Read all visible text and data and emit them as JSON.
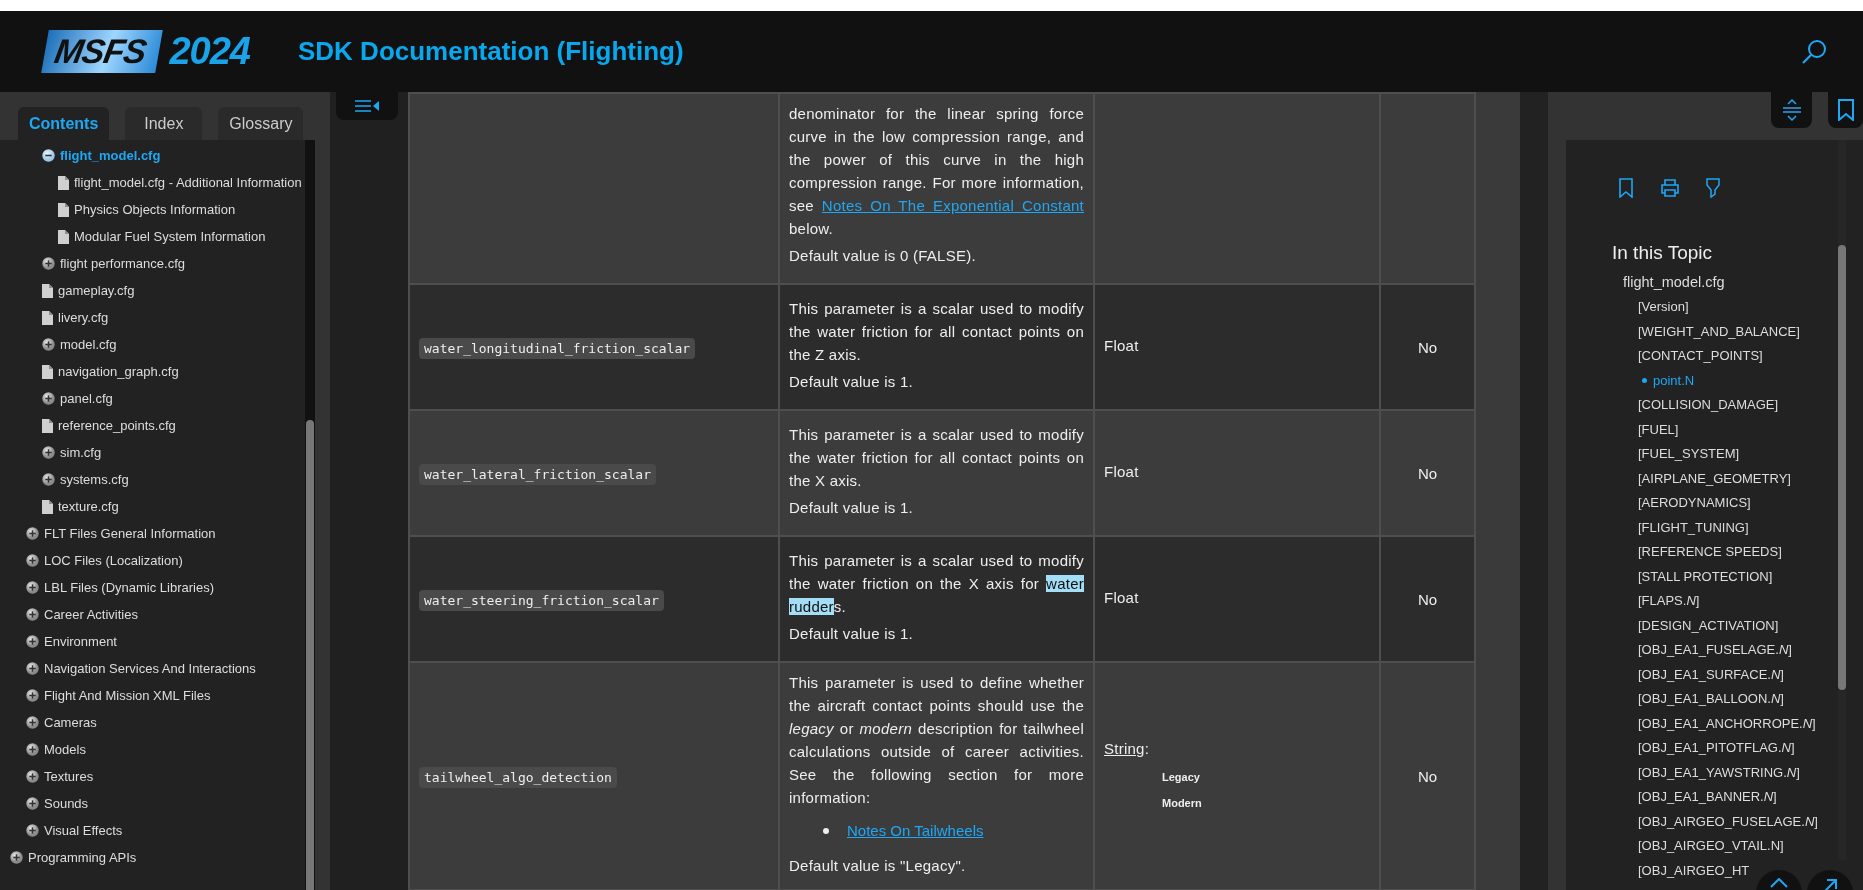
{
  "header": {
    "logo": {
      "mark": "MSFS",
      "year": "2024"
    },
    "title": "SDK Documentation (Flighting)"
  },
  "sidebar": {
    "tabs": [
      {
        "label": "Contents",
        "selected": true
      },
      {
        "label": "Index",
        "selected": false
      },
      {
        "label": "Glossary",
        "selected": false
      }
    ],
    "tree": [
      {
        "children": [
          {
            "children": [
              {
                "label": "flight_model.cfg",
                "kind": "folder",
                "expanded": true,
                "selected": true,
                "children": [
                  {
                    "label": "flight_model.cfg - Additional Information",
                    "kind": "page",
                    "selected": false
                  },
                  {
                    "label": "Physics Objects Information",
                    "kind": "page",
                    "selected": false
                  },
                  {
                    "label": "Modular Fuel System Information",
                    "kind": "page",
                    "selected": false
                  }
                ]
              },
              {
                "label": "flight performance.cfg",
                "kind": "folder",
                "expanded": false,
                "selected": false
              },
              {
                "label": "gameplay.cfg",
                "kind": "page",
                "selected": false
              },
              {
                "label": "livery.cfg",
                "kind": "page",
                "selected": false
              },
              {
                "label": "model.cfg",
                "kind": "folder",
                "expanded": false,
                "selected": false
              },
              {
                "label": "navigation_graph.cfg",
                "kind": "page",
                "selected": false
              },
              {
                "label": "panel.cfg",
                "kind": "folder",
                "expanded": false,
                "selected": false
              },
              {
                "label": "reference_points.cfg",
                "kind": "page",
                "selected": false
              },
              {
                "label": "sim.cfg",
                "kind": "folder",
                "expanded": false,
                "selected": false
              },
              {
                "label": "systems.cfg",
                "kind": "folder",
                "expanded": false,
                "selected": false
              },
              {
                "label": "texture.cfg",
                "kind": "page",
                "selected": false
              }
            ]
          },
          {
            "label": "FLT Files General Information",
            "kind": "folder",
            "expanded": false,
            "selected": false
          },
          {
            "label": "LOC Files (Localization)",
            "kind": "folder",
            "expanded": false,
            "selected": false
          },
          {
            "label": "LBL Files (Dynamic Libraries)",
            "kind": "folder",
            "expanded": false,
            "selected": false
          },
          {
            "label": "Career Activities",
            "kind": "folder",
            "expanded": false,
            "selected": false
          },
          {
            "label": "Environment",
            "kind": "folder",
            "expanded": false,
            "selected": false
          },
          {
            "label": "Navigation Services And Interactions",
            "kind": "folder",
            "expanded": false,
            "selected": false
          },
          {
            "label": "Flight And Mission XML Files",
            "kind": "folder",
            "expanded": false,
            "selected": false
          },
          {
            "label": "Cameras",
            "kind": "folder",
            "expanded": false,
            "selected": false
          },
          {
            "label": "Models",
            "kind": "folder",
            "expanded": false,
            "selected": false
          },
          {
            "label": "Textures",
            "kind": "folder",
            "expanded": false,
            "selected": false
          },
          {
            "label": "Sounds",
            "kind": "folder",
            "expanded": false,
            "selected": false
          },
          {
            "label": "Visual Effects",
            "kind": "folder",
            "expanded": false,
            "selected": false
          }
        ]
      },
      {
        "label": "Programming APIs",
        "kind": "folder",
        "expanded": false,
        "selected": false
      }
    ]
  },
  "table": {
    "rows": [
      {
        "description": [
          {
            "kind": "para",
            "segments": [
              {
                "kind": "text",
                "text": "denominator for the linear spring force curve in the low compression range, and the power of this curve in the high compression range. For more information, see "
              },
              {
                "kind": "link",
                "text": "Notes On The Exponential Constant"
              },
              {
                "kind": "text",
                "text": " below."
              }
            ]
          },
          {
            "kind": "para",
            "segments": [
              {
                "kind": "text",
                "text": "Default value is 0 (FALSE)."
              }
            ]
          }
        ]
      },
      {
        "name": "water_longitudinal_friction_scalar",
        "description": [
          {
            "kind": "para",
            "segments": [
              {
                "kind": "text",
                "text": "This parameter is a scalar used to modify the water friction for all contact points on the Z axis."
              }
            ]
          },
          {
            "kind": "para",
            "segments": [
              {
                "kind": "text",
                "text": "Default value is 1."
              }
            ]
          }
        ],
        "type": {
          "label": "Float",
          "linked": false
        },
        "required": "No"
      },
      {
        "name": "water_lateral_friction_scalar",
        "description": [
          {
            "kind": "para",
            "segments": [
              {
                "kind": "text",
                "text": "This parameter is a scalar used to modify the water friction for all contact points on the X axis."
              }
            ]
          },
          {
            "kind": "para",
            "segments": [
              {
                "kind": "text",
                "text": "Default value is 1."
              }
            ]
          }
        ],
        "type": {
          "label": "Float",
          "linked": false
        },
        "required": "No"
      },
      {
        "name": "water_steering_friction_scalar",
        "description": [
          {
            "kind": "para",
            "segments": [
              {
                "kind": "text",
                "text": "This parameter is a scalar used to modify the water friction on the X axis for "
              },
              {
                "kind": "highlight",
                "text": "water rudder"
              },
              {
                "kind": "text",
                "text": "s."
              }
            ]
          },
          {
            "kind": "para",
            "segments": [
              {
                "kind": "text",
                "text": "Default value is 1."
              }
            ]
          }
        ],
        "type": {
          "label": "Float",
          "linked": false
        },
        "required": "No"
      },
      {
        "name": "tailwheel_algo_detection",
        "description": [
          {
            "kind": "para",
            "segments": [
              {
                "kind": "text",
                "text": "This parameter is used to define whether the aircraft contact points should use the *legacy* or *modern* description for tailwheel calculations outside of career activities. See the following section for more information:"
              }
            ]
          },
          {
            "kind": "bullets",
            "items": [
              [
                {
                  "kind": "link",
                  "text": "Notes On Tailwheels"
                }
              ]
            ]
          },
          {
            "kind": "para",
            "segments": [
              {
                "kind": "text",
                "text": "Default value is \"Legacy\"."
              }
            ]
          }
        ],
        "type": {
          "label": "String",
          "linked": true,
          "suffix": ":",
          "values": [
            "Legacy",
            "Modern"
          ]
        },
        "required": "No"
      }
    ]
  },
  "topic_panel": {
    "title": "In this Topic",
    "items": [
      {
        "label": "flight_model.cfg",
        "selected": false,
        "children": [
          {
            "label": "[Version]",
            "selected": false
          },
          {
            "label": "[WEIGHT_AND_BALANCE]",
            "selected": false
          },
          {
            "label": "[CONTACT_POINTS]",
            "selected": false,
            "children": [
              {
                "label": "point.N",
                "selected": true
              }
            ]
          },
          {
            "label": "[COLLISION_DAMAGE]",
            "selected": false
          },
          {
            "label": "[FUEL]",
            "selected": false
          },
          {
            "label": "[FUEL_SYSTEM]",
            "selected": false
          },
          {
            "label": "[AIRPLANE_GEOMETRY]",
            "selected": false
          },
          {
            "label": "[AERODYNAMICS]",
            "selected": false
          },
          {
            "label": "[FLIGHT_TUNING]",
            "selected": false
          },
          {
            "label": "[REFERENCE SPEEDS]",
            "selected": false
          },
          {
            "label": "[STALL PROTECTION]",
            "selected": false
          },
          {
            "label": "[FLAPS.*N*]",
            "selected": false
          },
          {
            "label": "[DESIGN_ACTIVATION]",
            "selected": false
          },
          {
            "label": "[OBJ_EA1_FUSELAGE.*N*]",
            "selected": false
          },
          {
            "label": "[OBJ_EA1_SURFACE.*N*]",
            "selected": false
          },
          {
            "label": "[OBJ_EA1_BALLOON.*N*]",
            "selected": false
          },
          {
            "label": "[OBJ_EA1_ANCHORROPE.*N*]",
            "selected": false
          },
          {
            "label": "[OBJ_EA1_PITOTFLAG.*N*]",
            "selected": false
          },
          {
            "label": "[OBJ_EA1_YAWSTRING.*N*]",
            "selected": false
          },
          {
            "label": "[OBJ_EA1_BANNER.*N*]",
            "selected": false
          },
          {
            "label": "[OBJ_AIRGEO_FUSELAGE.*N*]",
            "selected": false
          },
          {
            "label": "[OBJ_AIRGEO_VTAIL.N]",
            "selected": false
          },
          {
            "label": "[OBJ_AIRGEO_HT",
            "selected": false
          }
        ]
      }
    ]
  }
}
